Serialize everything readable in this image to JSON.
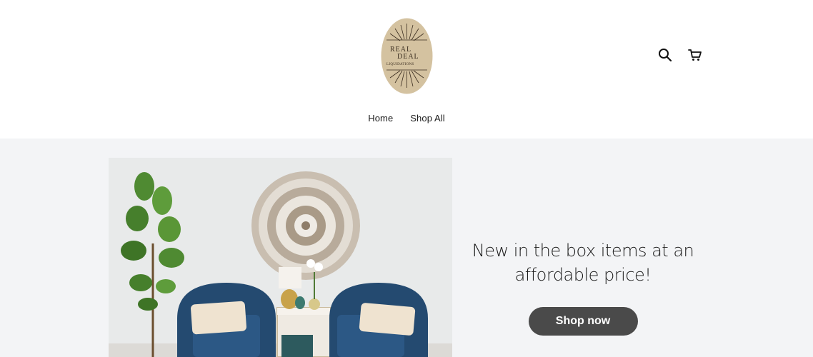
{
  "header": {
    "logo": {
      "line1": "REAL",
      "line2": "DEAL",
      "line3": "LIQUIDATIONS",
      "badge_color": "#d4c2a0",
      "ink_color": "#3a2d1f"
    },
    "icons": [
      "search-icon",
      "cart-icon"
    ]
  },
  "nav": {
    "items": [
      {
        "label": "Home"
      },
      {
        "label": "Shop All"
      }
    ]
  },
  "hero": {
    "heading": "New in the box items at an affordable price!",
    "button_label": "Shop now",
    "background": "#f3f4f6",
    "button_color": "#4a4a4a"
  }
}
